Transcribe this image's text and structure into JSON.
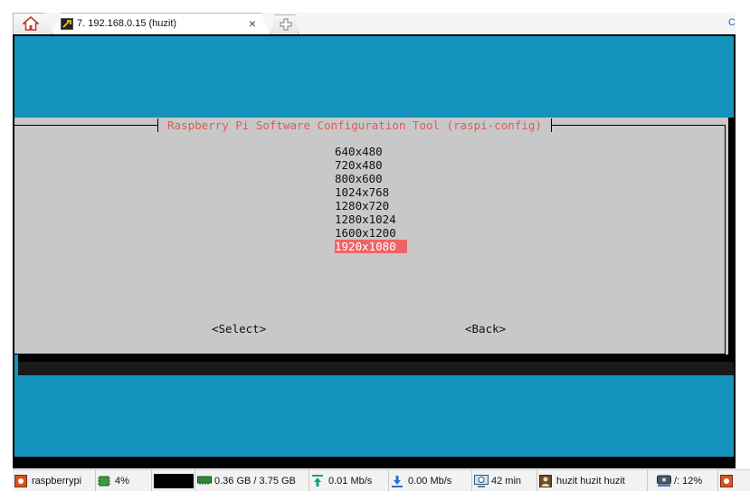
{
  "tabs": {
    "session_title": "7. 192.168.0.15 (huzit)",
    "close_glyph": "×",
    "more_glyph": "C"
  },
  "dialog": {
    "title": "Raspberry Pi Software Configuration Tool (raspi-config)",
    "options": [
      "640x480",
      "720x480",
      "800x600",
      "1024x768",
      "1280x720",
      "1280x1024",
      "1600x1200",
      "1920x1080"
    ],
    "selected": "1920x1080",
    "select_button": "<Select>",
    "back_button": "<Back>"
  },
  "status_bar": {
    "hostname": "raspberrypi",
    "cpu": "4%",
    "memory": "0.36 GB / 3.75 GB",
    "upload": "0.01 Mb/s",
    "download": "0.00 Mb/s",
    "uptime": "42 min",
    "user": "huzit  huzit  huzit",
    "disk": "/: 12%"
  },
  "colors": {
    "terminal_blue": "#1494bd",
    "dialog_gray": "#c8c8c8",
    "title_red": "#e05a5a",
    "highlight": "#ee6565"
  },
  "icons": {
    "home": "home-icon",
    "session": "ssh-session-icon",
    "new_tab": "new-tab-icon",
    "hostname": "raspberry-icon",
    "cpu": "cpu-icon",
    "memory": "memory-icon",
    "upload": "upload-arrow-icon",
    "download": "download-arrow-icon",
    "uptime": "clock-monitor-icon",
    "user": "user-icon",
    "disk": "disk-icon"
  }
}
